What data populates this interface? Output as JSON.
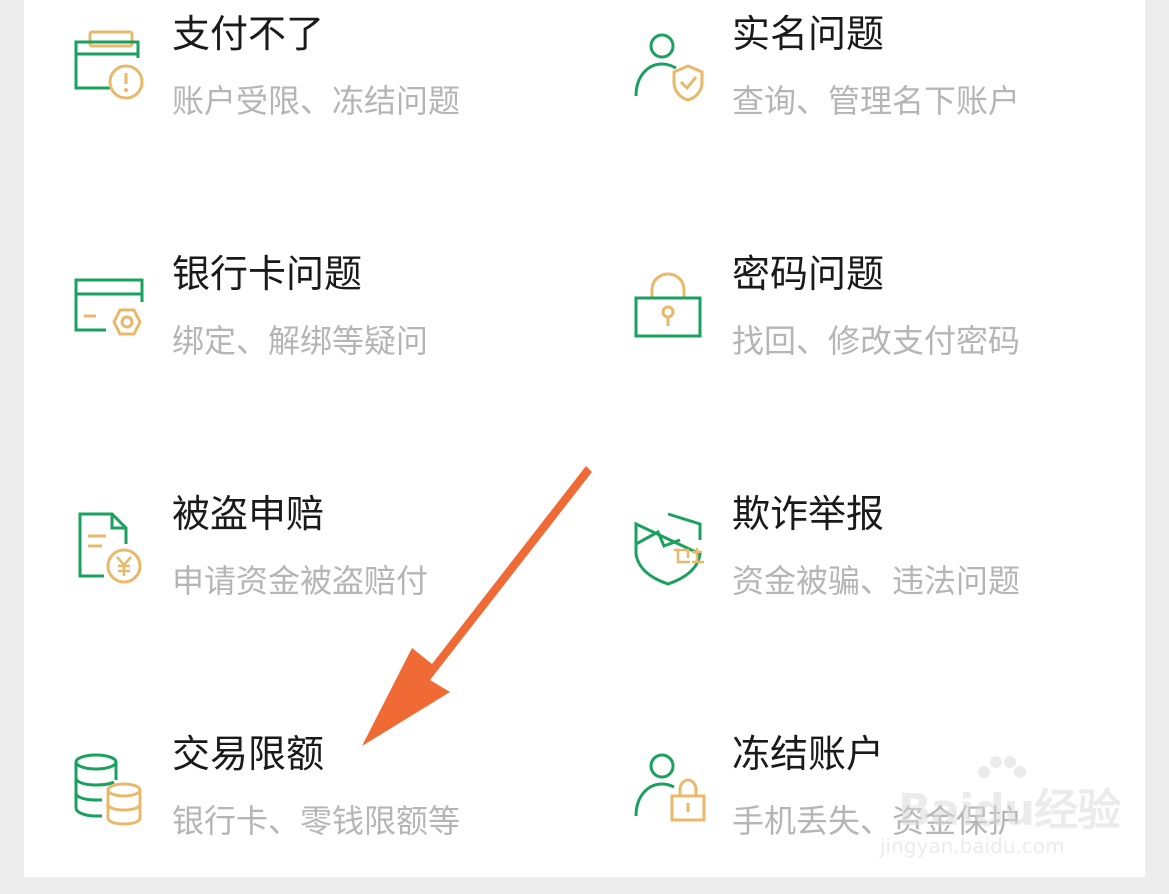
{
  "services": [
    {
      "id": "payment-failed",
      "title": "支付不了",
      "desc": "账户受限、冻结问题",
      "icon": "wallet-alert-icon"
    },
    {
      "id": "real-name",
      "title": "实名问题",
      "desc": "查询、管理名下账户",
      "icon": "person-shield-icon"
    },
    {
      "id": "bank-card",
      "title": "银行卡问题",
      "desc": "绑定、解绑等疑问",
      "icon": "card-gear-icon"
    },
    {
      "id": "password",
      "title": "密码问题",
      "desc": "找回、修改支付密码",
      "icon": "padlock-icon"
    },
    {
      "id": "theft-claim",
      "title": "被盗申赔",
      "desc": "申请资金被盗赔付",
      "icon": "document-yuan-icon"
    },
    {
      "id": "fraud-report",
      "title": "欺诈举报",
      "desc": "资金被骗、违法问题",
      "icon": "shield-guard-icon"
    },
    {
      "id": "transaction-limit",
      "title": "交易限额",
      "desc": "银行卡、零钱限额等",
      "icon": "coin-stack-icon"
    },
    {
      "id": "freeze-account",
      "title": "冻结账户",
      "desc": "手机丢失、资金保护",
      "icon": "person-lock-icon"
    }
  ],
  "colors": {
    "green": "#1aa160",
    "gold": "#e8b96a",
    "title": "#1a1a1a",
    "desc": "#b5b5b5",
    "arrow": "#f06a35"
  },
  "watermark": {
    "text": "Baidu经验",
    "sub": "jingyan.baidu.com"
  }
}
